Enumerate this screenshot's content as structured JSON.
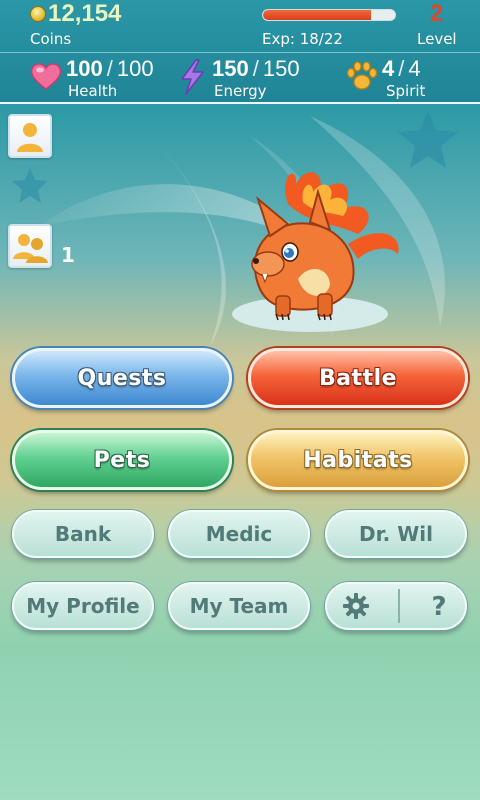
{
  "header": {
    "coins_value": "12,154",
    "coins_label": "Coins",
    "exp_label": "Exp: 18/22",
    "exp_progress": 0.82,
    "level_value": "2",
    "level_label": "Level"
  },
  "stats": {
    "health": {
      "current": "100",
      "separator": "/",
      "max": "100",
      "label": "Health",
      "icon": "heart-icon"
    },
    "energy": {
      "current": "150",
      "separator": "/",
      "max": "150",
      "label": "Energy",
      "icon": "lightning-icon"
    },
    "spirit": {
      "current": "4",
      "separator": "/",
      "max": "4",
      "label": "Spirit",
      "icon": "paw-icon"
    }
  },
  "scene": {
    "profile_icon": "person-icon",
    "team_icon": "group-icon",
    "team_count": "1",
    "pet": "fire-fox-pet"
  },
  "buttons": {
    "quests": "Quests",
    "battle": "Battle",
    "pets": "Pets",
    "habitats": "Habitats",
    "bank": "Bank",
    "medic": "Medic",
    "dr_wil": "Dr. Wil",
    "my_profile": "My Profile",
    "my_team": "My Team",
    "settings_icon": "gear-icon",
    "help_icon": "question-icon"
  },
  "colors": {
    "header_bg": "#1f8496",
    "coins": "#e8f5c0",
    "level": "#e0462a",
    "exp_fill": "#e8502a",
    "quests": "#4a8fd6",
    "battle": "#e94a2a",
    "pets": "#3fbb76",
    "habitats": "#e8b450",
    "small_button_text": "#527a78"
  }
}
